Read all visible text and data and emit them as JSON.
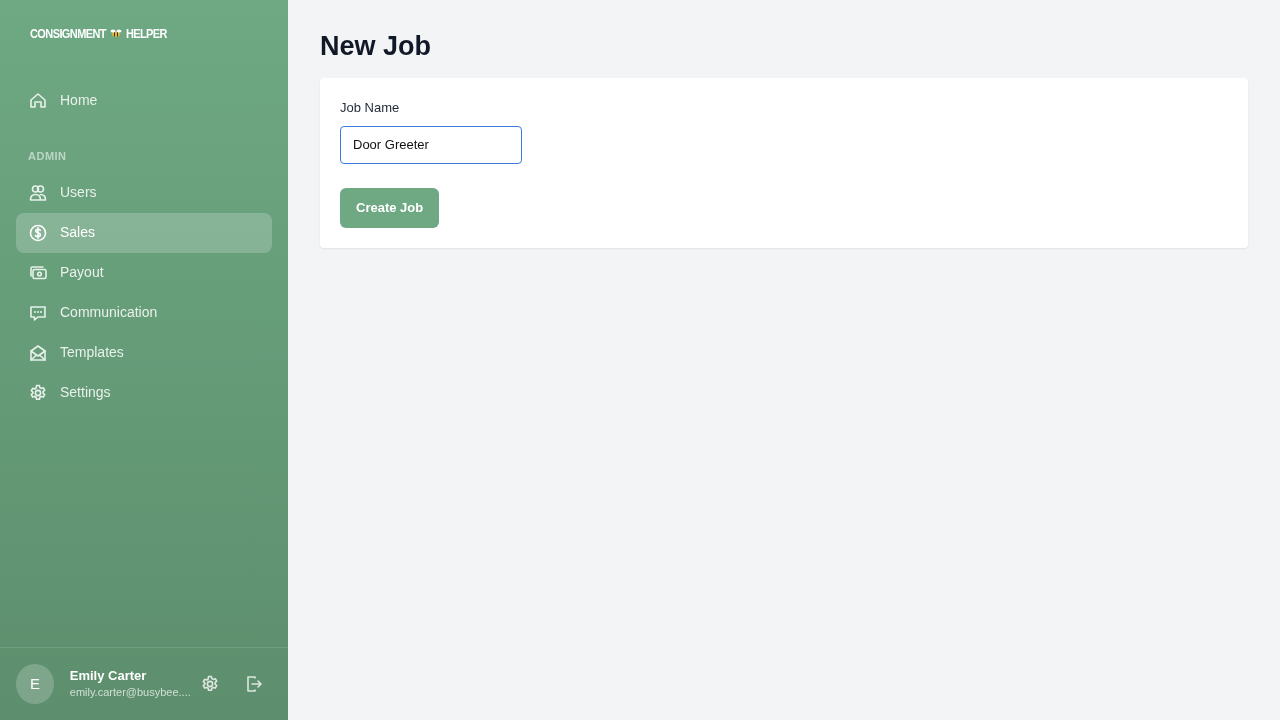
{
  "sidebar": {
    "logo": {
      "left": "CONSIGNMENT",
      "right": "HELPER"
    },
    "nav": [
      {
        "label": "Home",
        "selected": false
      }
    ],
    "section_heading": "ADMIN",
    "admin_nav": [
      {
        "label": "Users",
        "selected": false
      },
      {
        "label": "Sales",
        "selected": true
      },
      {
        "label": "Payout",
        "selected": false
      },
      {
        "label": "Communication",
        "selected": false
      },
      {
        "label": "Templates",
        "selected": false
      },
      {
        "label": "Settings",
        "selected": false
      }
    ],
    "user": {
      "initial": "E",
      "name": "Emily Carter",
      "email": "emily.carter@busybee...."
    }
  },
  "page": {
    "title": "New Job",
    "form": {
      "label": "Job Name",
      "value": "Door Greeter",
      "button": "Create Job"
    }
  }
}
